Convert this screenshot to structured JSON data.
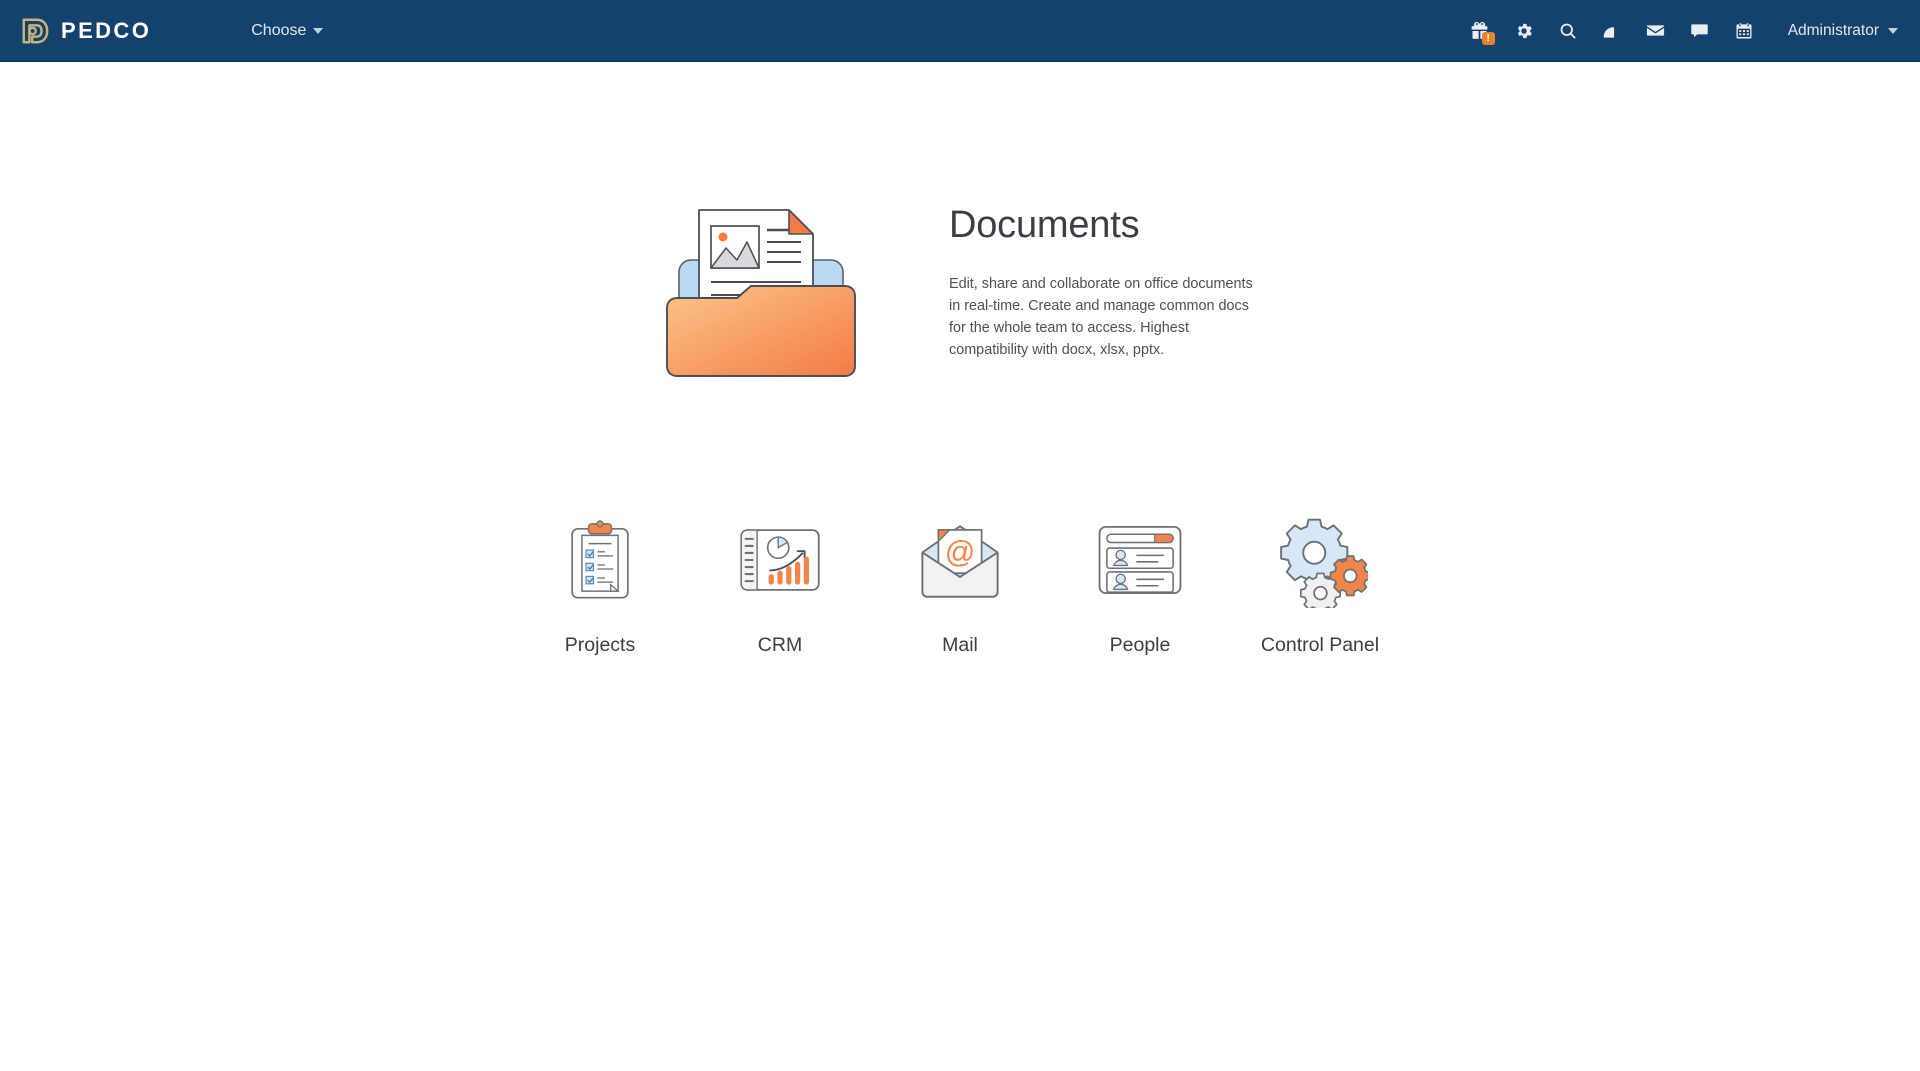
{
  "header": {
    "brand": {
      "name": "PEDCO",
      "logo_icon": "pedco-d-logo",
      "logo_color": "#C9B37A"
    },
    "choose": {
      "label": "Choose",
      "icon": "chevron-down-icon"
    },
    "icons": [
      {
        "name": "gift-icon",
        "title": "Gift",
        "badge": "!"
      },
      {
        "name": "gear-icon",
        "title": "Settings"
      },
      {
        "name": "search-icon",
        "title": "Search"
      },
      {
        "name": "gauge-icon",
        "title": "Speed"
      },
      {
        "name": "envelope-icon",
        "title": "Mail"
      },
      {
        "name": "chat-bubble-icon",
        "title": "Messages"
      },
      {
        "name": "calendar-icon",
        "title": "Calendar"
      }
    ],
    "user": {
      "name": "Administrator",
      "icon": "chevron-down-icon"
    },
    "background_color": "#14426F"
  },
  "hero": {
    "illustration": "documents-folder-illustration",
    "title": "Documents",
    "description": "Edit, share and collaborate on office documents in real-time. Create and manage common docs for the whole team to access. Highest compatibility with docx, xlsx, pptx."
  },
  "apps": [
    {
      "label": "Projects",
      "icon": "clipboard-checklist-icon"
    },
    {
      "label": "CRM",
      "icon": "chart-analytics-icon"
    },
    {
      "label": "Mail",
      "icon": "envelope-at-icon"
    },
    {
      "label": "People",
      "icon": "contact-cards-icon"
    },
    {
      "label": "Control Panel",
      "icon": "gears-icon"
    }
  ],
  "colors": {
    "header_bg": "#14426F",
    "accent_orange": "#F08B4C",
    "accent_blue": "#BBD9F2",
    "text_dark": "#3b3f45",
    "page_bg": "#ffffff"
  }
}
